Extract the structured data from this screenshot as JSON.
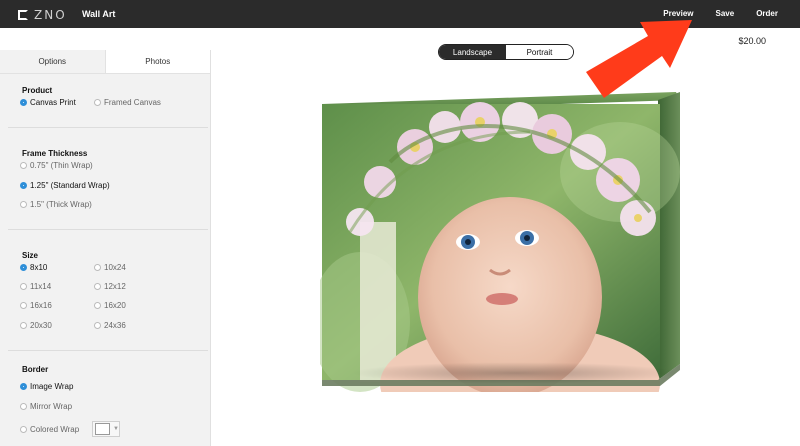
{
  "topbar": {
    "logo_text": "ZNO",
    "title": "Wall Art",
    "actions": [
      "Preview",
      "Save",
      "Order"
    ]
  },
  "sidebar": {
    "tabs": [
      "Options",
      "Photos"
    ],
    "product": {
      "title": "Product",
      "options": [
        "Canvas Print",
        "Framed Canvas"
      ],
      "selected": "Canvas Print"
    },
    "frame_thickness": {
      "title": "Frame Thickness",
      "options": [
        "0.75\" (Thin Wrap)",
        "1.25\" (Standard Wrap)",
        "1.5\" (Thick Wrap)"
      ],
      "selected": "1.25\" (Standard Wrap)"
    },
    "size": {
      "title": "Size",
      "options": [
        "8x10",
        "10x24",
        "11x14",
        "12x12",
        "16x16",
        "16x20",
        "20x30",
        "24x36"
      ],
      "selected": "8x10"
    },
    "border": {
      "title": "Border",
      "options": [
        "Image Wrap",
        "Mirror Wrap",
        "Colored Wrap"
      ],
      "selected": "Image Wrap"
    }
  },
  "main": {
    "orientation": [
      "Landscape",
      "Portrait"
    ],
    "orientation_selected": "Landscape",
    "price": "$20.00"
  },
  "colors": {
    "topbar": "#2b2b2b",
    "accent": "#2f8fd8",
    "arrow": "#ff3b1a"
  }
}
